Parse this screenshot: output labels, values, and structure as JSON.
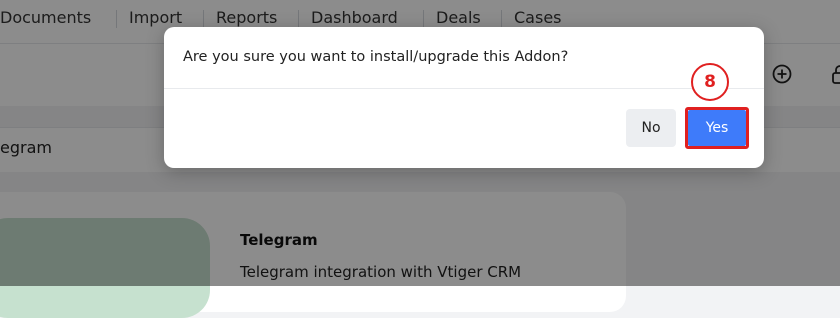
{
  "topnav": {
    "items": [
      {
        "label": "Documents"
      },
      {
        "label": "Import"
      },
      {
        "label": "Reports"
      },
      {
        "label": "Dashboard"
      },
      {
        "label": "Deals"
      },
      {
        "label": "Cases"
      }
    ]
  },
  "toolbar": {
    "icons": [
      "add-circle-icon",
      "lock-icon"
    ]
  },
  "breadcrumb": {
    "text": "egram"
  },
  "addon_card": {
    "title": "Telegram",
    "description": "Telegram integration with Vtiger CRM"
  },
  "dialog": {
    "message": "Are you sure you want to install/upgrade this Addon?",
    "no_label": "No",
    "yes_label": "Yes"
  },
  "annotation": {
    "step_number": "8",
    "color": "#e02020"
  },
  "colors": {
    "primary_button": "#3e7bfa",
    "secondary_button": "#eceef1"
  }
}
